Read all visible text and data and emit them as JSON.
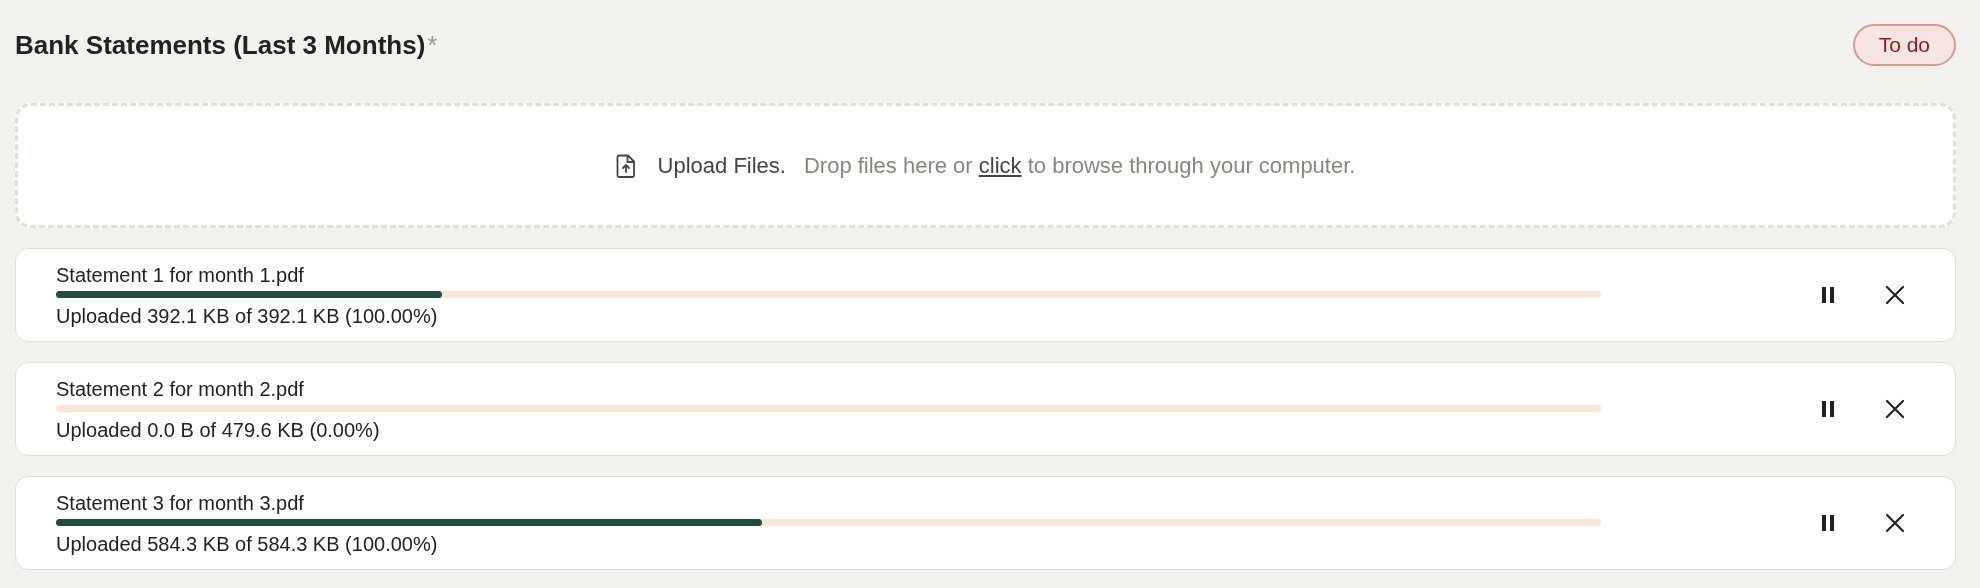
{
  "header": {
    "title": "Bank Statements (Last 3 Months)",
    "required_mark": "*",
    "status_badge": "To do"
  },
  "dropzone": {
    "label": "Upload Files.",
    "hint_before": "Drop files here or",
    "link": "click",
    "hint_after": "to browse through your computer."
  },
  "files": [
    {
      "name": "Statement 1 for month 1.pdf",
      "level": 0.25,
      "status": "Uploaded 392.1 KB of 392.1 KB (100.00%)"
    },
    {
      "name": "Statement 2 for month 2.pdf",
      "status": "Uploaded 0.0 B of 479.6 KB (0.00%)"
    },
    {
      "name": "Statement 3 for month 3.pdf",
      "level": 0.457,
      "status": "Uploaded 584.3 KB of 584.3 KB (100.00%)"
    }
  ]
}
